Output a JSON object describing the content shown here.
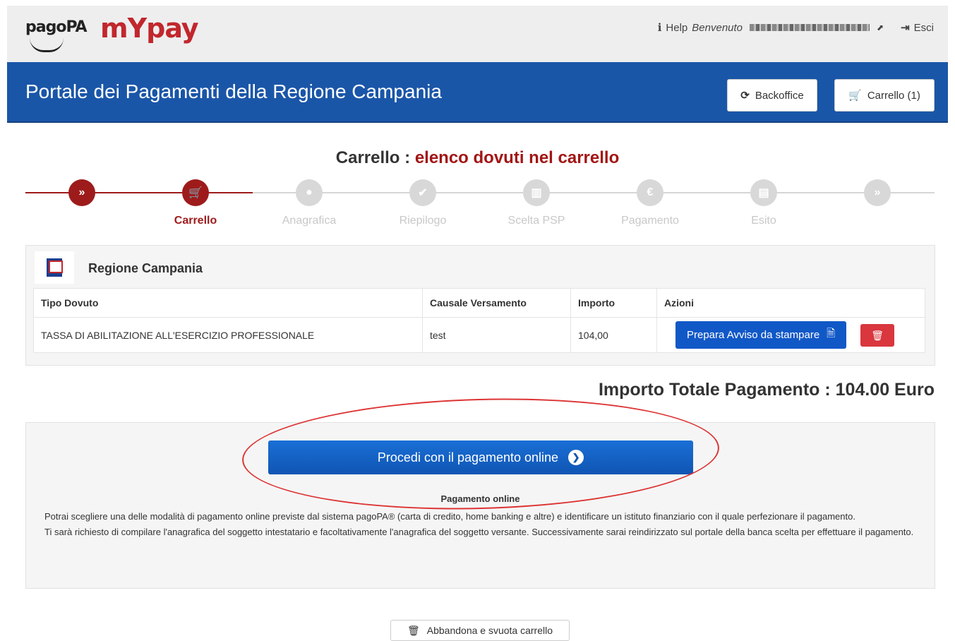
{
  "header": {
    "logo_pagopa": "pagoPA",
    "logo_my": "mY",
    "logo_pay": "pay",
    "help": "Help",
    "welcome": "Benvenuto",
    "exit": "Esci"
  },
  "banner": {
    "title": "Portale dei Pagamenti della Regione Campania",
    "backoffice_label": "Backoffice",
    "cart_label": "Carrello (1)"
  },
  "page": {
    "title_prefix": "Carrello :",
    "title_suffix": "elenco dovuti nel carrello"
  },
  "steps": [
    {
      "label": "",
      "icon": "»",
      "active": true
    },
    {
      "label": "Carrello",
      "icon": "🛒",
      "active": true
    },
    {
      "label": "Anagrafica",
      "icon": "●",
      "active": false
    },
    {
      "label": "Riepilogo",
      "icon": "✔",
      "active": false
    },
    {
      "label": "Scelta PSP",
      "icon": "▥",
      "active": false
    },
    {
      "label": "Pagamento",
      "icon": "€",
      "active": false
    },
    {
      "label": "Esito",
      "icon": "▤",
      "active": false
    },
    {
      "label": "",
      "icon": "»",
      "active": false
    }
  ],
  "cart": {
    "entity": "Regione Campania",
    "columns": [
      "Tipo Dovuto",
      "Causale Versamento",
      "Importo",
      "Azioni"
    ],
    "rows": [
      {
        "tipo": "TASSA DI ABILITAZIONE ALL'ESERCIZIO PROFESSIONALE",
        "causale": "test",
        "importo": "104,00"
      }
    ],
    "prepare_label": "Prepara Avviso da stampare"
  },
  "total": "Importo Totale Pagamento : 104.00 Euro",
  "payment": {
    "proceed_label": "Procedi con il pagamento online",
    "heading": "Pagamento online",
    "text1": "Potrai scegliere una delle modalità di pagamento online previste dal sistema pagoPA® (carta di credito, home banking e altre) e identificare un istituto finanziario con il quale perfezionare il pagamento.",
    "text2": "Ti sarà richiesto di compilare l'anagrafica del soggetto intestatario e facoltativamente l'anagrafica del soggetto versante. Successivamente sarai reindirizzato sul portale della banca scelta per effettuare il pagamento."
  },
  "abandon_label": "Abbandona e svuota carrello",
  "colors": {
    "banner": "#1a56a8",
    "accent": "#9e1b1b",
    "primary": "#1158c7",
    "danger": "#d9363e"
  }
}
